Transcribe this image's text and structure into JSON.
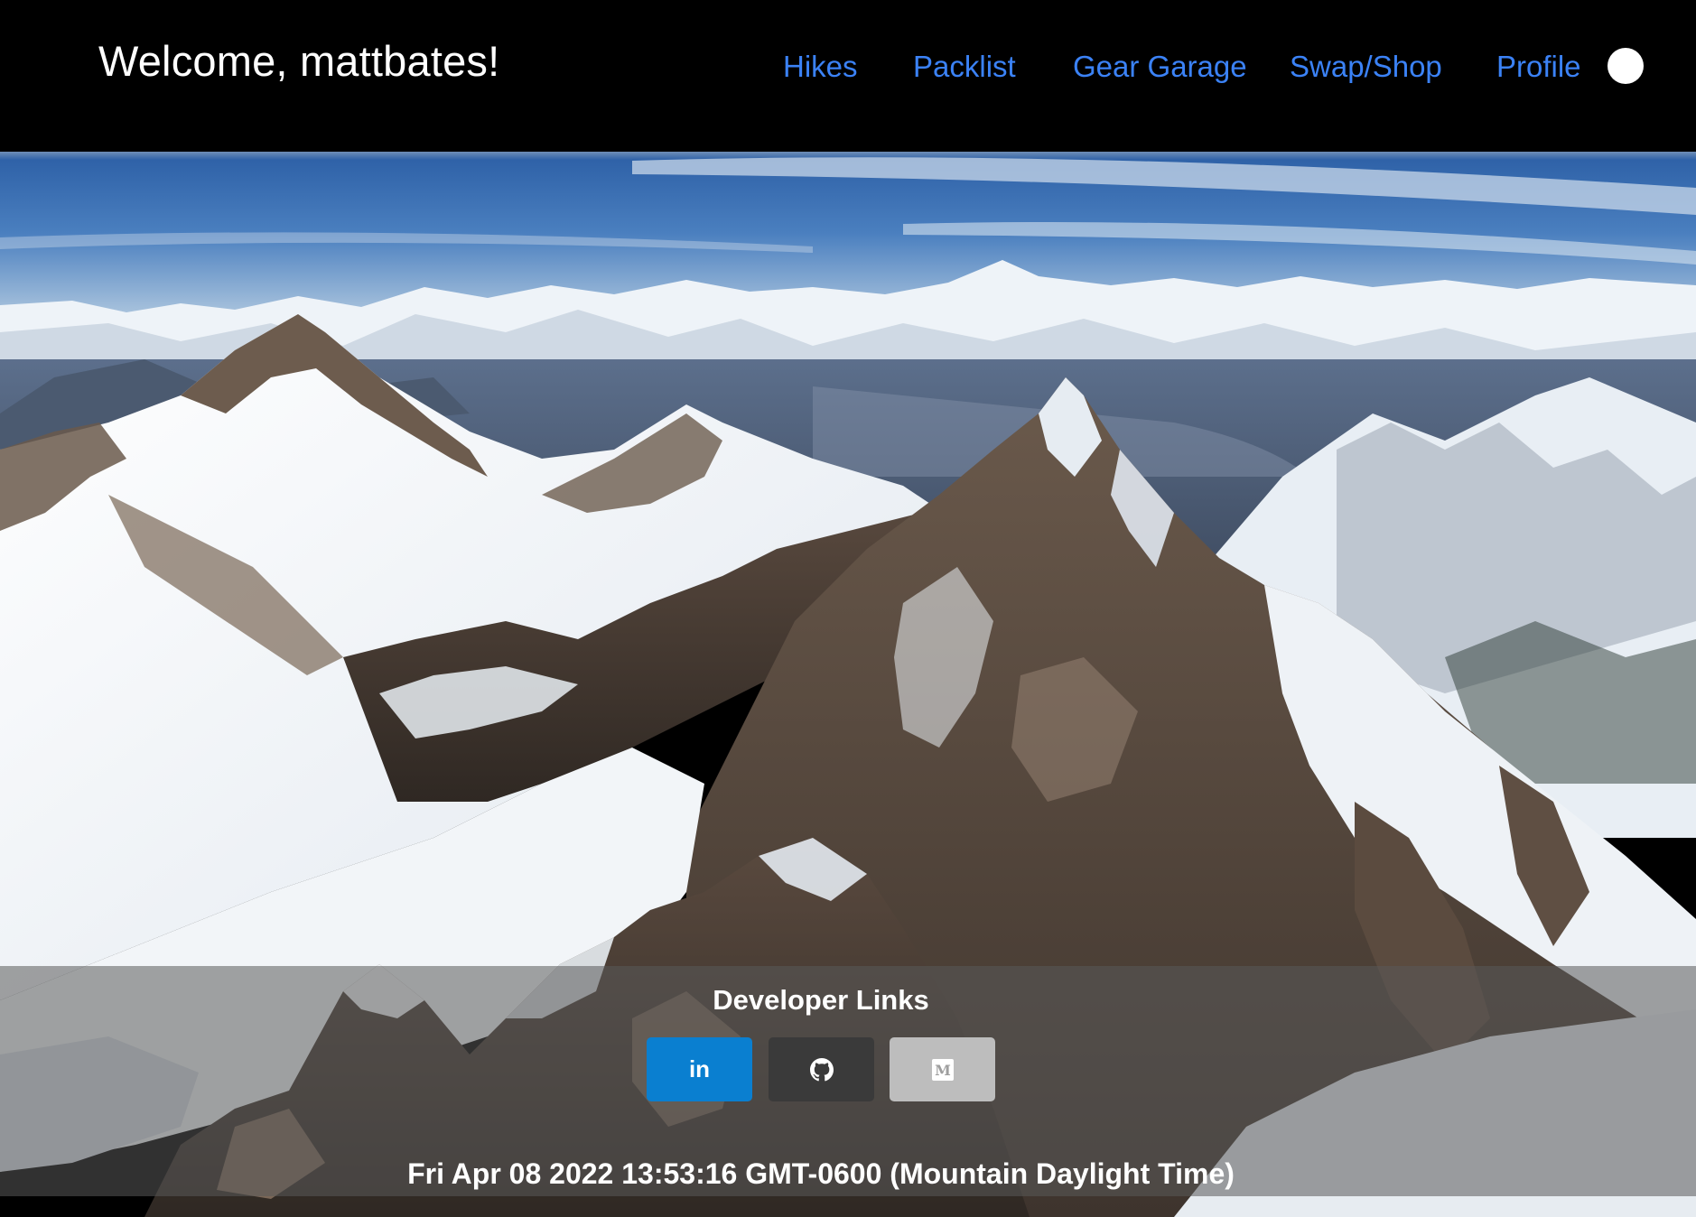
{
  "header": {
    "welcome_text": "Welcome, mattbates!",
    "nav": {
      "hikes": "Hikes",
      "packlist": "Packlist",
      "gear_garage": "Gear Garage",
      "swap_shop": "Swap/Shop",
      "profile": "Profile"
    },
    "link_color": "#3b82f6",
    "background_color": "#000000"
  },
  "hero": {
    "image_icon": "mountain-landscape"
  },
  "footer": {
    "title": "Developer Links",
    "buttons": {
      "linkedin": {
        "icon": "linkedin-icon",
        "label": "in",
        "color": "#0a7fd0"
      },
      "github": {
        "icon": "github-icon",
        "color": "#3a3a3a"
      },
      "medium": {
        "icon": "medium-icon",
        "label": "M",
        "color": "#bdbdbd"
      }
    },
    "timestamp": "Fri Apr 08 2022 13:53:16 GMT-0600 (Mountain Daylight Time)"
  }
}
